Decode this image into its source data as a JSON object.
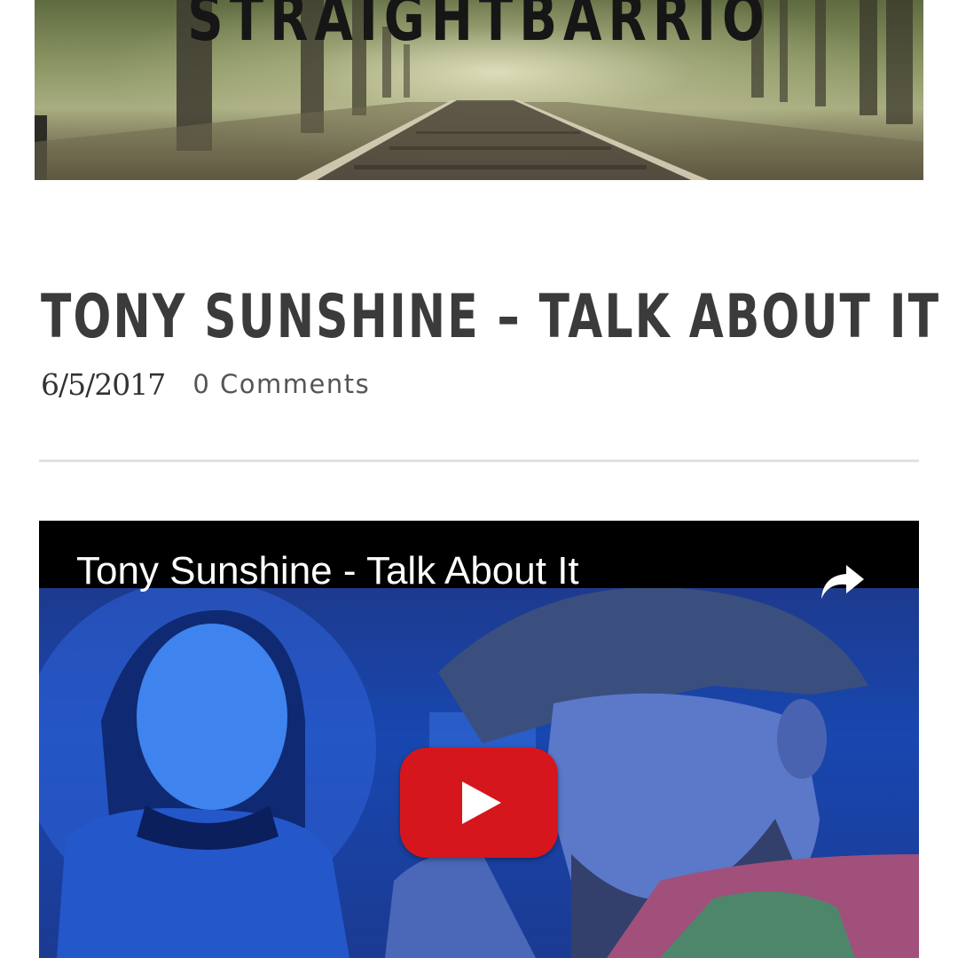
{
  "site": {
    "title": "STRAIGHTBARRIO"
  },
  "post": {
    "title": "TONY SUNSHINE – TALK ABOUT IT",
    "date": "6/5/2017",
    "comments": "0 Comments"
  },
  "video": {
    "title": "Tony Sunshine - Talk About It",
    "share_icon": "share-arrow-icon",
    "play_icon": "youtube-play-icon",
    "play_color": "#d5161d"
  }
}
